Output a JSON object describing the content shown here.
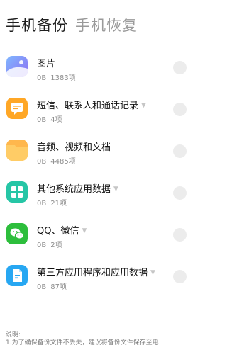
{
  "tabs": [
    {
      "label": "手机备份"
    },
    {
      "label": "手机恢复"
    }
  ],
  "items": [
    {
      "title": "图片",
      "size": "0B",
      "count": "1383项",
      "has_arrow": false,
      "icon": "image-icon"
    },
    {
      "title": "短信、联系人和通话记录",
      "size": "0B",
      "count": "4项",
      "has_arrow": true,
      "icon": "message-icon"
    },
    {
      "title": "音频、视频和文档",
      "size": "0B",
      "count": "4485项",
      "has_arrow": false,
      "icon": "folder-icon"
    },
    {
      "title": "其他系统应用数据",
      "size": "0B",
      "count": "21项",
      "has_arrow": true,
      "icon": "apps-grid-icon"
    },
    {
      "title": "QQ、微信",
      "size": "0B",
      "count": "2项",
      "has_arrow": true,
      "icon": "wechat-icon"
    },
    {
      "title": "第三方应用程序和应用数据",
      "size": "0B",
      "count": "87项",
      "has_arrow": true,
      "icon": "app-file-icon"
    }
  ],
  "note": {
    "title": "说明:",
    "line1": "1.为了确保备份文件不丢失，建议将备份文件保存至电"
  },
  "colors": {
    "orange": "#FFA726",
    "teal": "#26C6A6",
    "green": "#2DBE3C",
    "blue": "#27A7F2",
    "purple": "#7A78F4"
  }
}
